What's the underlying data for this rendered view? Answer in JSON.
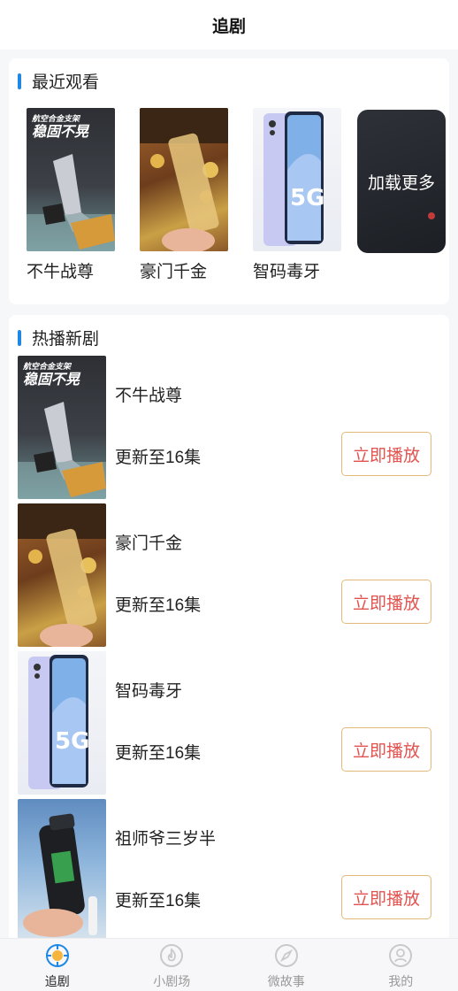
{
  "header": {
    "title": "追剧"
  },
  "recent": {
    "title": "最近观看",
    "items": [
      {
        "label": "不牛战尊",
        "thumb": "phone-stand"
      },
      {
        "label": "豪门千金",
        "thumb": "bakery-cup"
      },
      {
        "label": "智码毒牙",
        "thumb": "smartphone-5g"
      }
    ],
    "load_more": "加载更多",
    "stand_text_small": "航空合金支架",
    "stand_text_big": "稳固不晃"
  },
  "hot": {
    "title": "热播新剧",
    "play_label": "立即播放",
    "items": [
      {
        "name": "不牛战尊",
        "update": "更新至16集",
        "thumb": "phone-stand"
      },
      {
        "name": "豪门千金",
        "update": "更新至16集",
        "thumb": "bakery-cup"
      },
      {
        "name": "智码毒牙",
        "update": "更新至16集",
        "thumb": "smartphone-5g"
      },
      {
        "name": "祖师爷三岁半",
        "update": "更新至16集",
        "thumb": "water-bottle"
      }
    ]
  },
  "tabbar": {
    "active": 0,
    "items": [
      {
        "label": "追剧",
        "icon": "target-icon"
      },
      {
        "label": "小剧场",
        "icon": "flame-icon"
      },
      {
        "label": "微故事",
        "icon": "compass-icon"
      },
      {
        "label": "我的",
        "icon": "user-icon"
      }
    ]
  },
  "colors": {
    "accent": "#1e88e5",
    "play_text": "#e2534f",
    "play_border": "#e3b979"
  }
}
